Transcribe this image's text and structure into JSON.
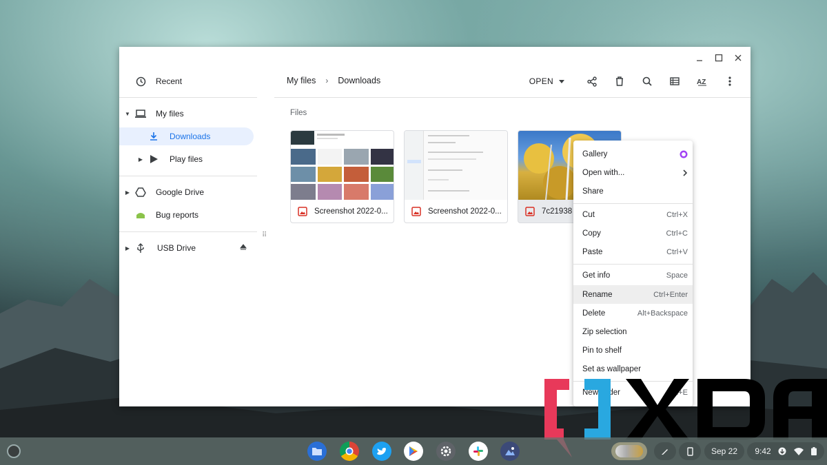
{
  "window": {
    "controls": {
      "minimize": "–",
      "maximize": "□",
      "close": "✕"
    }
  },
  "sidebar": {
    "recent": "Recent",
    "my_files": "My files",
    "downloads": "Downloads",
    "play_files": "Play files",
    "google_drive": "Google Drive",
    "bug_reports": "Bug reports",
    "usb_drive": "USB Drive"
  },
  "breadcrumb": {
    "root": "My files",
    "current": "Downloads"
  },
  "toolbar": {
    "open_label": "OPEN"
  },
  "main": {
    "section_label": "Files",
    "files": [
      {
        "name": "Screenshot 2022-0..."
      },
      {
        "name": "Screenshot 2022-0..."
      },
      {
        "name": "7c21938"
      }
    ]
  },
  "context_menu": {
    "items": [
      {
        "label": "Gallery",
        "shortcut": ""
      },
      {
        "label": "Open with...",
        "shortcut": ""
      },
      {
        "label": "Share",
        "shortcut": ""
      },
      {
        "label": "Cut",
        "shortcut": "Ctrl+X"
      },
      {
        "label": "Copy",
        "shortcut": "Ctrl+C"
      },
      {
        "label": "Paste",
        "shortcut": "Ctrl+V"
      },
      {
        "label": "Get info",
        "shortcut": "Space"
      },
      {
        "label": "Rename",
        "shortcut": "Ctrl+Enter"
      },
      {
        "label": "Delete",
        "shortcut": "Alt+Backspace"
      },
      {
        "label": "Zip selection",
        "shortcut": ""
      },
      {
        "label": "Pin to shelf",
        "shortcut": ""
      },
      {
        "label": "Set as wallpaper",
        "shortcut": ""
      },
      {
        "label": "New folder",
        "shortcut": "Ctrl+E"
      }
    ]
  },
  "shelf": {
    "date": "Sep 22",
    "time": "9:42",
    "apps": [
      "files-icon",
      "chrome-icon",
      "twitter-icon",
      "play-store-icon",
      "settings-icon",
      "slack-icon",
      "gallery-icon"
    ]
  },
  "watermark": {
    "text": "XDA"
  },
  "colors": {
    "accent": "#1a73e8",
    "selected_bg": "#e8f0fe",
    "image_icon": "#d93025"
  }
}
